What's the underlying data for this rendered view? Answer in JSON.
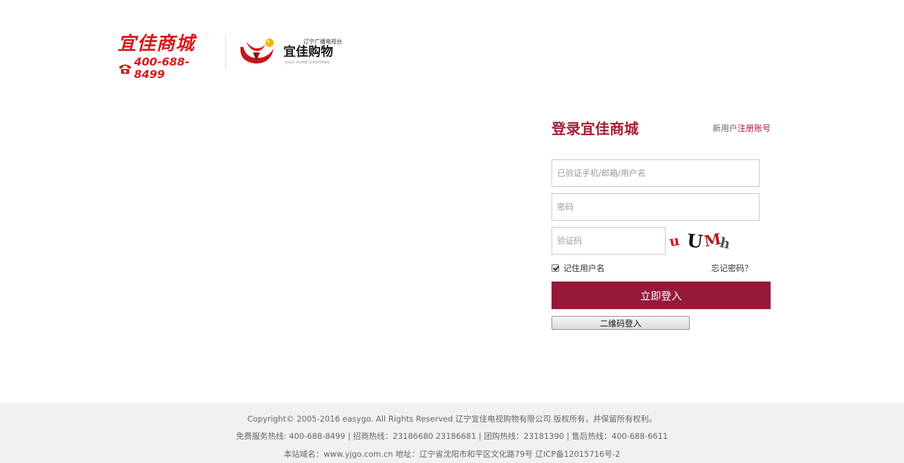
{
  "header": {
    "brand_name": "宜佳商城",
    "hotline": "400-688-8499",
    "partner_tagline": "辽宁广播电视台",
    "partner_name": "宜佳购物",
    "partner_name_en": "YJGO HOME SHOPPING"
  },
  "login": {
    "title": "登录宜佳商城",
    "new_user_text": "新用户",
    "register_link": "注册账号",
    "username_placeholder": "已验证手机/邮箱/用户名",
    "password_placeholder": "密码",
    "captcha_placeholder": "验证码",
    "captcha_text": "uUMh",
    "remember_label": "记住用户名",
    "remember_checked": true,
    "forgot_link": "忘记密码？",
    "login_button": "立即登入",
    "qr_login_button": "二维码登入"
  },
  "footer": {
    "copyright": "Copyright© 2005-2016 easygo. All Rights Reserved 辽宁宜佳电视购物有限公司  版权所有，并保留所有权利。",
    "hotlines": "免费服务热线: 400-688-8499 | 招商热线：23186680 23186681 | 团购热线：23181390 | 售后热线：400-688-6611",
    "site_info": "本站域名：www.yjgo.com.cn  地址：辽宁省沈阳市和平区文化路79号  辽ICP备12015716号-2"
  },
  "colors": {
    "brand_red": "#d9191f",
    "primary": "#96193c",
    "title_red": "#a31d38",
    "footer_bg": "#f1f1f1"
  }
}
